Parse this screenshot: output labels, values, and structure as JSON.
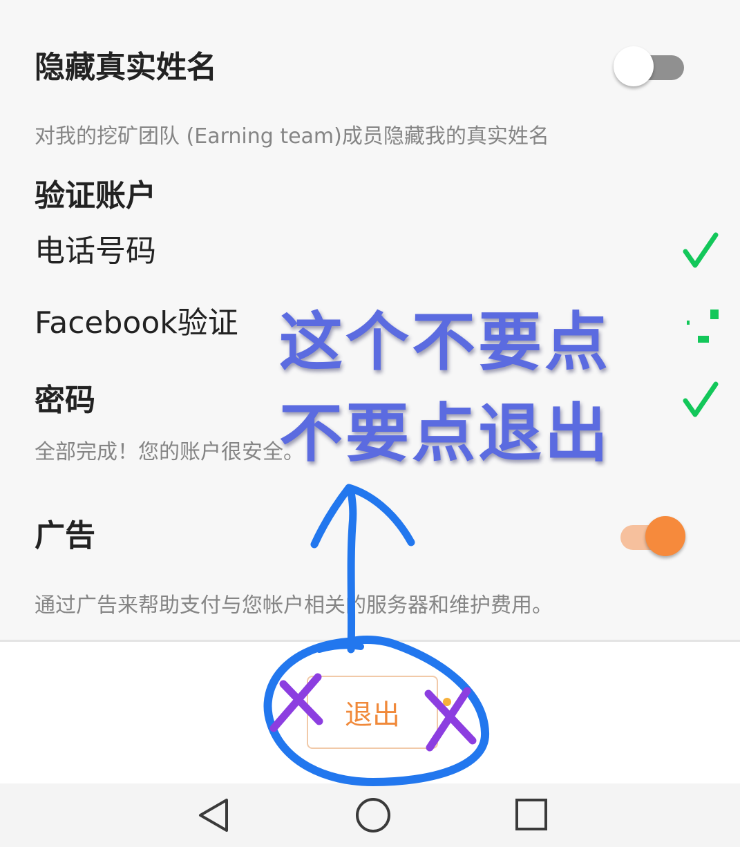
{
  "settings": {
    "hide_name": {
      "title": "隐藏真实姓名",
      "description": "对我的挖矿团队 (Earning team)成员隐藏我的真实姓名",
      "enabled": false
    },
    "verify": {
      "title": "验证账户",
      "phone_label": "电话号码",
      "phone_verified": true,
      "facebook_label": "Facebook验证",
      "facebook_verified": true
    },
    "password": {
      "title": "密码",
      "description": "全部完成！您的账户很安全。",
      "set": true
    },
    "ads": {
      "title": "广告",
      "description": "通过广告来帮助支付与您帐户相关的服务器和维护费用。",
      "enabled": true
    }
  },
  "logout_button": {
    "label": "退出"
  },
  "annotation": {
    "line1": "这个不要点",
    "line2": "不要点退出"
  },
  "nav": {
    "back_icon": "triangle-back-icon",
    "home_icon": "circle-home-icon",
    "recents_icon": "square-recents-icon"
  },
  "colors": {
    "accent_orange": "#f68a3c",
    "check_green": "#13c75a",
    "annotation_blue": "#5b6be0",
    "circle_blue": "#2277ee",
    "cross_purple": "#8c3ee0"
  }
}
